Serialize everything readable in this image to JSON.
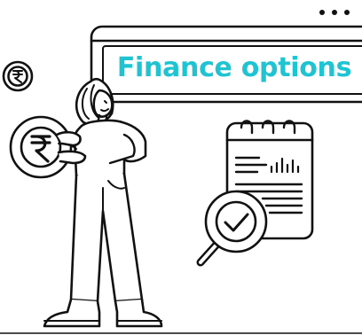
{
  "card": {
    "title": "Finance options",
    "title_color": "#1fc4d2"
  },
  "coin": {
    "symbol": "₹"
  },
  "menu": {
    "icon": "more-horizontal-icon"
  },
  "colors": {
    "ink": "#111111",
    "accent": "#1fc4d2",
    "background": "#ffffff"
  }
}
